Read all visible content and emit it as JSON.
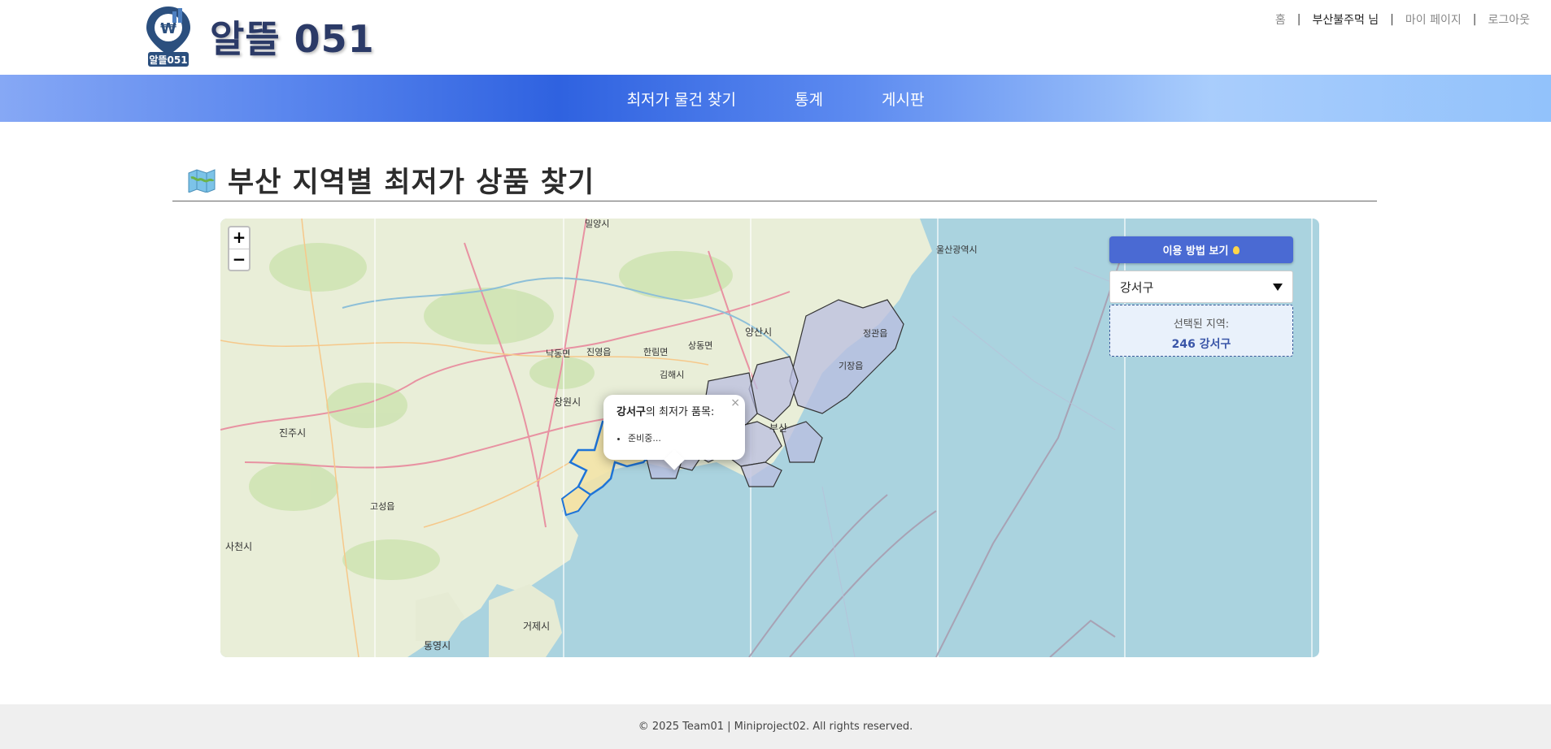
{
  "header": {
    "logo_title": "알뜰 051",
    "logo_badge_text": "알뜰051",
    "links": {
      "home": "홈",
      "user": "부산불주먹 님",
      "mypage": "마이 페이지",
      "logout": "로그아웃"
    }
  },
  "nav": {
    "items": [
      "최저가 물건 찾기",
      "통계",
      "게시판"
    ]
  },
  "page": {
    "title": "부산 지역별 최저가 상품 찾기"
  },
  "map": {
    "zoom_in": "+",
    "zoom_out": "−",
    "how_to_button": "이용 방법 보기",
    "region_select_value": "강서구",
    "selected_label": "선택된 지역:",
    "selected_value": "246 강서구",
    "popup": {
      "region": "강서구",
      "title_suffix": "의 최저가 품목:",
      "items": [
        "준비중..."
      ],
      "close": "×"
    },
    "place_labels": [
      "밀양시",
      "창원시",
      "진주시",
      "사천시",
      "거제시",
      "통영시",
      "양산시",
      "김해시",
      "울산광역시",
      "부산",
      "고성읍",
      "낙동면",
      "진영읍",
      "한림면",
      "상동면",
      "기장읍",
      "정관읍"
    ],
    "colors": {
      "sea": "#aad3df",
      "land": "#e9eed8",
      "selected_fill": "#f3e3a8",
      "selected_stroke": "#1e74d8",
      "district_fill": "#b9bde0"
    }
  },
  "footer": {
    "text": "© 2025 Team01 | Miniproject02. All rights reserved."
  }
}
